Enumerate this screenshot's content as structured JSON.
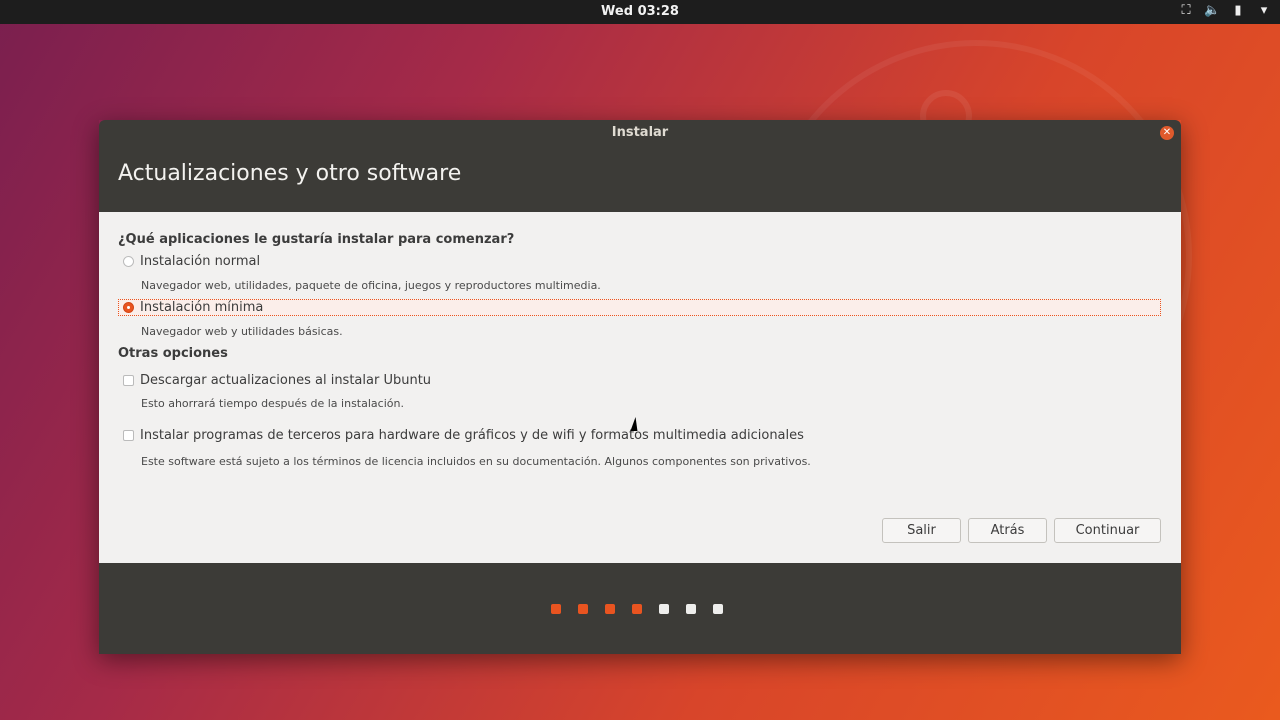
{
  "topbar": {
    "clock": "Wed 03:28",
    "icons": [
      "network-icon",
      "volume-icon",
      "battery-icon",
      "menu-arrow-icon"
    ]
  },
  "window": {
    "title": "Instalar",
    "heading": "Actualizaciones y otro software",
    "question": "¿Qué aplicaciones le gustaría instalar para comenzar?",
    "options": [
      {
        "label": "Instalación normal",
        "description": "Navegador web, utilidades, paquete de oficina, juegos y reproductores multimedia.",
        "selected": false
      },
      {
        "label": "Instalación mínima",
        "description": "Navegador web y utilidades básicas.",
        "selected": true
      }
    ],
    "other_heading": "Otras opciones",
    "checks": [
      {
        "label": "Descargar actualizaciones al instalar Ubuntu",
        "description": "Esto ahorrará tiempo después de la instalación.",
        "checked": false
      },
      {
        "label": "Instalar programas de terceros para hardware de gráficos y de wifi y formatos multimedia adicionales",
        "description": "Este software está sujeto a los términos de licencia incluidos en su documentación. Algunos componentes son privativos.",
        "checked": false
      }
    ],
    "buttons": {
      "quit": "Salir",
      "back": "Atrás",
      "continue": "Continuar"
    },
    "progress": {
      "steps_total": 7,
      "steps_done": 4,
      "done_color": "#e95420",
      "pending_color": "#eeeeec"
    }
  }
}
